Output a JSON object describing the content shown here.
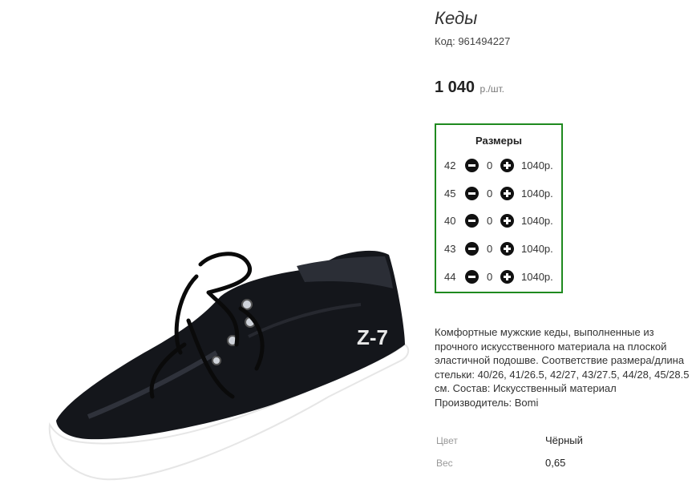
{
  "product": {
    "title": "Кеды",
    "code": "Код: 961494227",
    "price": "1 040",
    "price_unit": "р./шт."
  },
  "sizes": {
    "title": "Размеры",
    "rows": [
      {
        "size": "42",
        "qty": "0",
        "price": "1040р."
      },
      {
        "size": "45",
        "qty": "0",
        "price": "1040р."
      },
      {
        "size": "40",
        "qty": "0",
        "price": "1040р."
      },
      {
        "size": "43",
        "qty": "0",
        "price": "1040р."
      },
      {
        "size": "44",
        "qty": "0",
        "price": "1040р."
      }
    ]
  },
  "description": "Комфортные мужские кеды, выполненные из прочного искусственного материала на плоской эластичной подошве. Соответствие размера/длина стельки: 40/26, 41/26.5, 42/27, 43/27.5, 44/28, 45/28.5 см. Состав: Искусственный материал Производитель: Bomi",
  "properties": [
    {
      "label": "Цвет",
      "value": "Чёрный"
    },
    {
      "label": "Вес",
      "value": "0,65"
    }
  ],
  "image": {
    "logo_text": "Z-7"
  },
  "icons": {
    "minus": "minus-circle-icon",
    "plus": "plus-circle-icon"
  },
  "colors": {
    "sizes_border": "#1f8a1f",
    "button": "#111111"
  }
}
